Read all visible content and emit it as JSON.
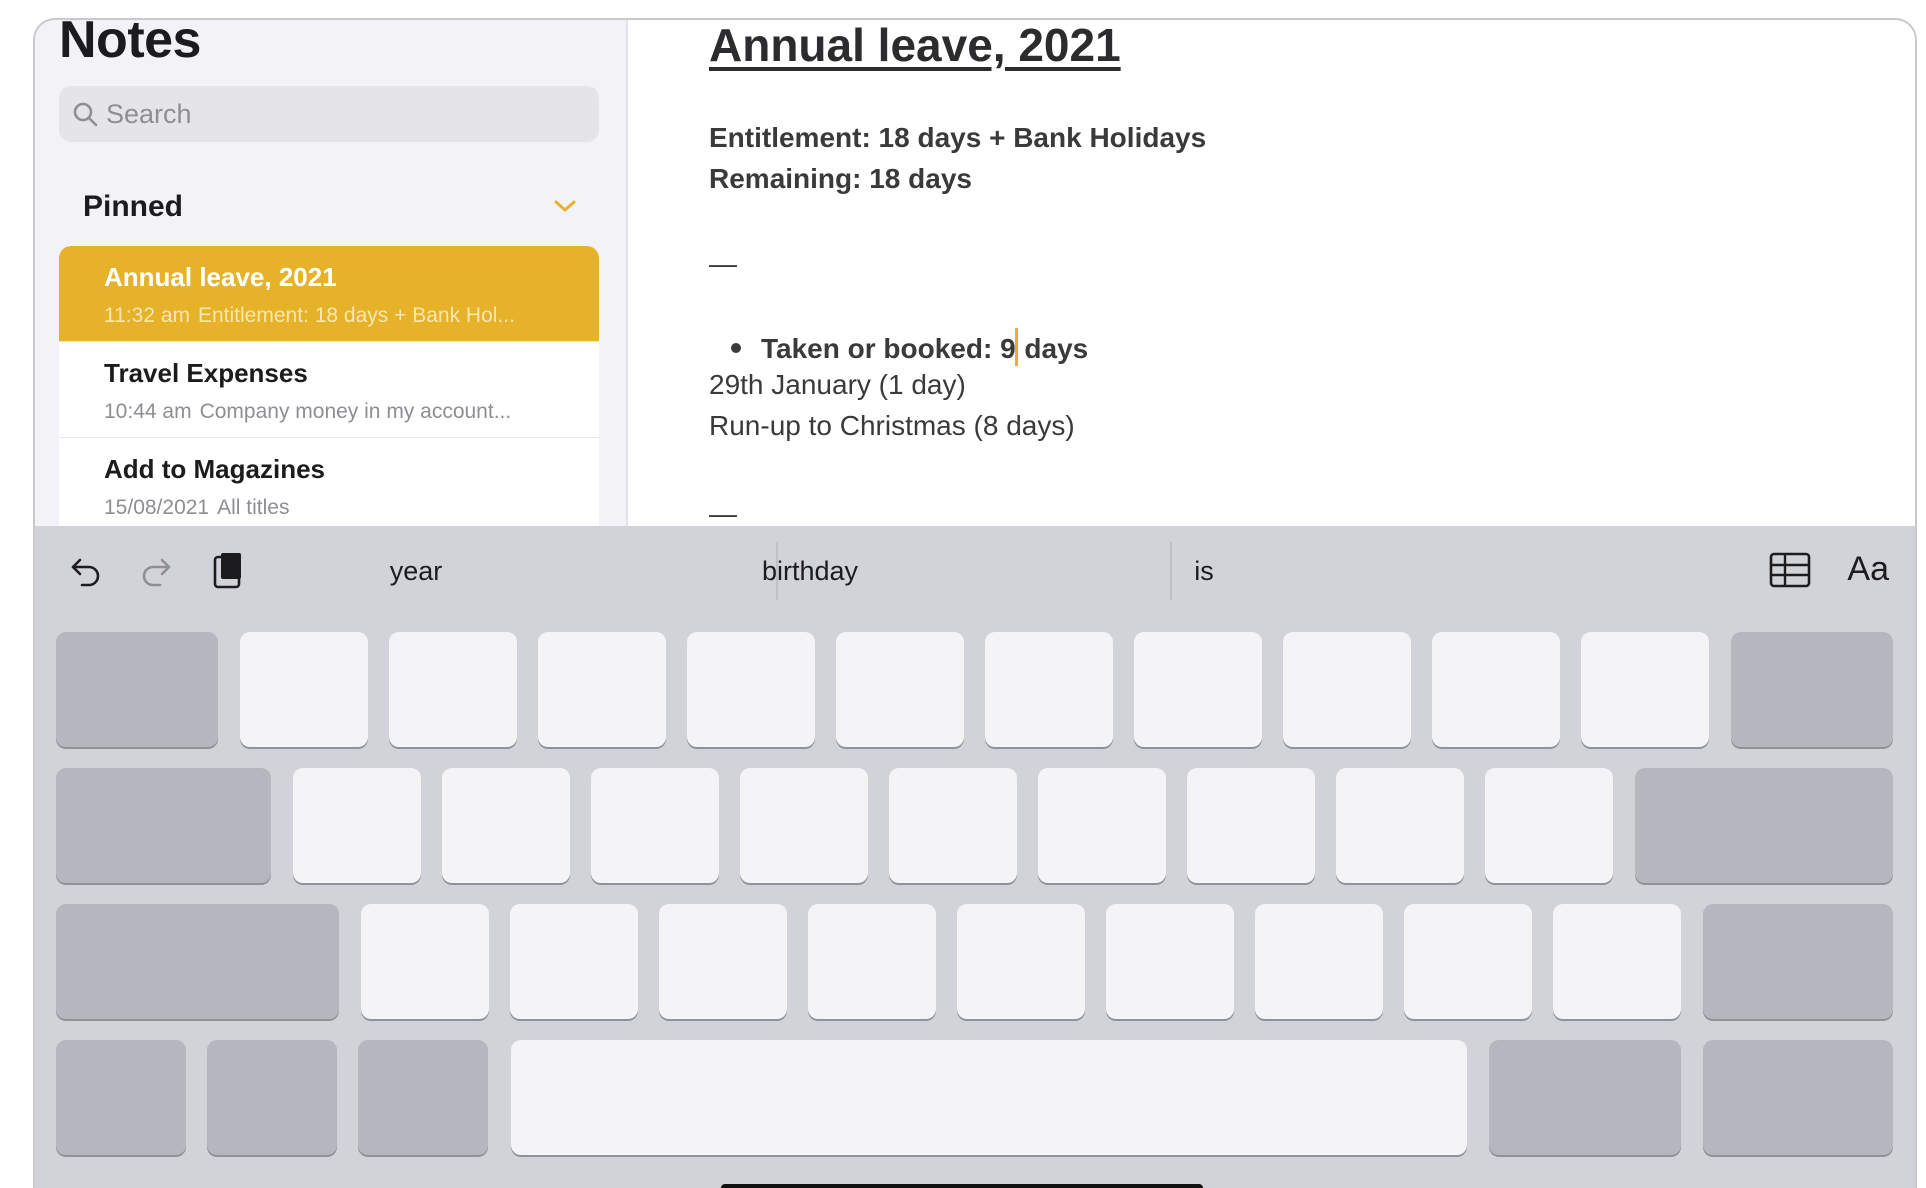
{
  "sidebar": {
    "title": "Notes",
    "search": {
      "placeholder": "Search"
    },
    "pinned_label": "Pinned",
    "notes": [
      {
        "title": "Annual leave, 2021",
        "time": "11:32 am",
        "preview": "Entitlement: 18 days + Bank Hol...",
        "selected": true
      },
      {
        "title": "Travel Expenses",
        "time": "10:44 am",
        "preview": "Company money in my account...",
        "selected": false
      },
      {
        "title": "Add to Magazines",
        "time": "15/08/2021",
        "preview": "All titles",
        "selected": false
      }
    ]
  },
  "editor": {
    "title": "Annual leave, 2021",
    "entitlement": "Entitlement: 18 days + Bank Holidays",
    "remaining": "Remaining: 18 days",
    "separator": "—",
    "bullet_before_cursor": "Taken or booked: 9",
    "bullet_after_cursor": " days",
    "line_january": "29th January (1 day)",
    "line_christmas": "Run-up to Christmas (8 days)",
    "separator2": "—"
  },
  "keyboard": {
    "suggestions": [
      "year",
      "birthday",
      "is"
    ],
    "format_label": "Aa",
    "icons": [
      "undo-icon",
      "redo-icon",
      "paste-icon",
      "table-icon"
    ]
  },
  "colors": {
    "accent": "#e5b22a",
    "keyboard_bg": "#d1d3d9",
    "key_light": "#f4f4f6",
    "key_dark": "#b4b7be"
  }
}
